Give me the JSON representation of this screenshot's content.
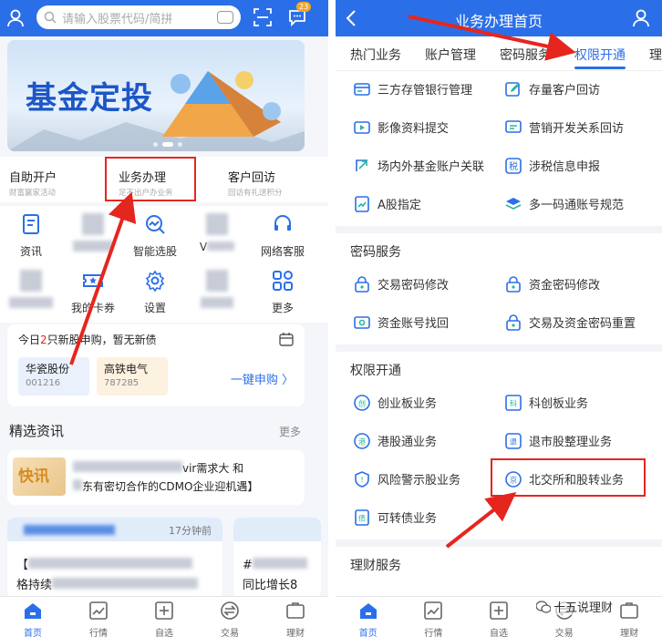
{
  "left": {
    "search": {
      "placeholder": "请输入股票代码/简拼"
    },
    "badge": "23",
    "banner": {
      "title": "基金定投"
    },
    "cards": [
      {
        "title": "自助开户",
        "sub": "财富赢家活动"
      },
      {
        "title": "业务办理",
        "sub": "足不出户办业务"
      },
      {
        "title": "客户回访",
        "sub": "回访有礼送积分"
      }
    ],
    "grid": [
      {
        "label": "资讯",
        "icon": "news-icon",
        "blur": false
      },
      {
        "label": "",
        "icon": "blurred-icon",
        "blur": true
      },
      {
        "label": "智能选股",
        "icon": "smart-stock-icon",
        "blur": false
      },
      {
        "label": "V",
        "icon": "blurred-icon",
        "blur": true
      },
      {
        "label": "网络客服",
        "icon": "headset-icon",
        "blur": false
      },
      {
        "label": "",
        "icon": "blurred-icon",
        "blur": true
      },
      {
        "label": "我的卡券",
        "icon": "coupon-icon",
        "blur": false
      },
      {
        "label": "设置",
        "icon": "gear-icon",
        "blur": false
      },
      {
        "label": "",
        "icon": "blurred-icon",
        "blur": true
      },
      {
        "label": "更多",
        "icon": "more-grid-icon",
        "blur": false
      }
    ],
    "ipo": {
      "prefix": "今日",
      "count": "2",
      "suffix": "只新股申购，暂无新债",
      "stocks": [
        {
          "name": "华瓷股份",
          "code": "001216"
        },
        {
          "name": "高铁电气",
          "code": "787285"
        }
      ],
      "action": "一键申购 〉"
    },
    "news": {
      "header": "精选资讯",
      "more": "更多",
      "flash_tag": "快讯",
      "flash_line1": "vir需求大 和",
      "flash_line2": "东有密切合作的CDMO企业迎机遇】",
      "card1_time": "17分钟前",
      "card1_line1": "【",
      "card1_line2": "格持续",
      "card2_line1": "#",
      "card2_line2": "同比增长8"
    },
    "tabs": [
      "首页",
      "行情",
      "自选",
      "交易",
      "理财"
    ]
  },
  "right": {
    "title": "业务办理首页",
    "tabs": [
      "热门业务",
      "账户管理",
      "密码服务",
      "权限开通",
      "理"
    ],
    "hot": [
      {
        "label": "三方存管银行管理",
        "icon": "bank-card-icon"
      },
      {
        "label": "存量客户回访",
        "icon": "edit-icon"
      },
      {
        "label": "影像资料提交",
        "icon": "video-icon"
      },
      {
        "label": "营销开发关系回访",
        "icon": "chat-icon"
      },
      {
        "label": "场内外基金账户关联",
        "icon": "link-icon"
      },
      {
        "label": "涉税信息申报",
        "icon": "tax-icon"
      },
      {
        "label": "A股指定",
        "icon": "chart-doc-icon"
      },
      {
        "label": "多一码通账号规范",
        "icon": "layers-icon"
      }
    ],
    "pwd_title": "密码服务",
    "pwd": [
      {
        "label": "交易密码修改",
        "icon": "lock-icon"
      },
      {
        "label": "资金密码修改",
        "icon": "lock-icon"
      },
      {
        "label": "资金账号找回",
        "icon": "card-search-icon"
      },
      {
        "label": "交易及资金密码重置",
        "icon": "lock-reset-icon"
      }
    ],
    "perm_title": "权限开通",
    "perm": [
      {
        "label": "创业板业务",
        "icon": "chuang-icon",
        "glyph": "创"
      },
      {
        "label": "科创板业务",
        "icon": "ke-icon",
        "glyph": "科"
      },
      {
        "label": "港股通业务",
        "icon": "hk-icon",
        "glyph": "港"
      },
      {
        "label": "退市股整理业务",
        "icon": "delist-icon",
        "glyph": "退"
      },
      {
        "label": "风险警示股业务",
        "icon": "warning-shield-icon",
        "glyph": "!"
      },
      {
        "label": "北交所和股转业务",
        "icon": "jing-icon",
        "glyph": "京"
      },
      {
        "label": "可转债业务",
        "icon": "bond-icon",
        "glyph": "债"
      }
    ],
    "fin_title": "理财服务",
    "tabs_bottom": [
      "首页",
      "行情",
      "自选",
      "交易",
      "理财"
    ],
    "watermark": "十五说理财"
  },
  "colors": {
    "brand": "#2b6fe8",
    "highlight": "#e5261f"
  }
}
